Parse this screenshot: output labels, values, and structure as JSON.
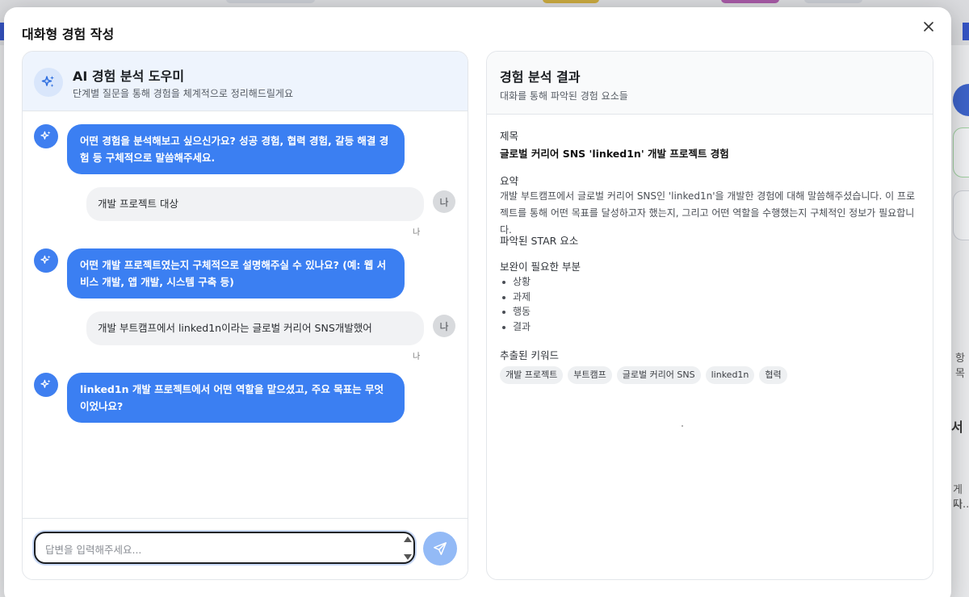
{
  "modal": {
    "title": "대화형 경험 작성",
    "close_icon": "×"
  },
  "assistant": {
    "title": "AI 경험 분석 도우미",
    "subtitle": "단계별 질문을 통해 경험을 체계적으로 정리해드릴게요"
  },
  "chat": {
    "messages": [
      {
        "role": "bot",
        "text": "어떤 경험을 분석해보고 싶으신가요? 성공 경험, 협력 경험, 갈등 해결 경험 등 구체적으로 말씀해주세요."
      },
      {
        "role": "user",
        "text": "개발 프로젝트 대상",
        "avatar": "나",
        "name": "나"
      },
      {
        "role": "bot",
        "text": "어떤 개발 프로젝트였는지 구체적으로 설명해주실 수 있나요? (예: 웹 서비스 개발, 앱 개발, 시스템 구축 등)"
      },
      {
        "role": "user",
        "text": "개발 부트캠프에서 linked1n이라는 글로벌 커리어 SNS개발했어",
        "avatar": "나",
        "name": "나"
      },
      {
        "role": "bot",
        "text": "linked1n 개발 프로젝트에서 어떤 역할을 맡으셨고, 주요 목표는 무엇이었나요?"
      }
    ]
  },
  "input": {
    "placeholder": "답변을 입력해주세요...",
    "value": ""
  },
  "result": {
    "title": "경험 분석 결과",
    "subtitle": "대화를 통해 파악된 경험 요소들",
    "title_label": "제목",
    "title_value": "글로벌 커리어 SNS 'linked1n' 개발 프로젝트 경험",
    "summary_label": "요약",
    "summary_text": "개발 부트캠프에서 글로벌 커리어 SNS인 'linked1n'을 개발한 경험에 대해 말씀해주셨습니다. 이 프로젝트를 통해 어떤 목표를 달성하고자 했는지, 그리고 어떤 역할을 수행했는지 구체적인 정보가 필요합니다.",
    "star_label": "파악된 STAR 요소",
    "needs_label": "보완이 필요한 부분",
    "needs": [
      "상황",
      "과제",
      "행동",
      "결과"
    ],
    "keywords_label": "추출된 키워드",
    "keywords": [
      "개발 프로젝트",
      "부트캠프",
      "글로벌 커리어 SNS",
      "linked1n",
      "협력"
    ]
  },
  "background": {
    "text_1": "항목",
    "text_2": "서",
    "text_3": "게시",
    "text_4": "다...."
  },
  "colors": {
    "primary": "#3b7ff2",
    "send_disabled": "#93baf6",
    "header_tint": "#eef4fd"
  }
}
